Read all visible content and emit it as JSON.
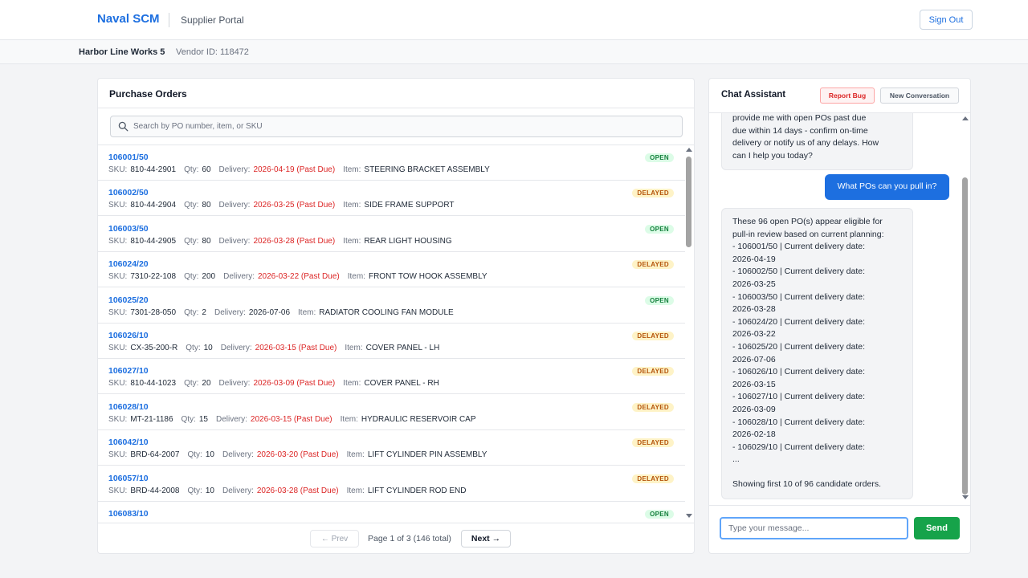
{
  "header": {
    "brand": "Naval SCM",
    "portal": "Supplier Portal",
    "sign_out": "Sign Out"
  },
  "vendor": {
    "name": "Harbor Line Works 5",
    "id_text": "Vendor ID: 118472"
  },
  "orders": {
    "title": "Purchase Orders",
    "search_placeholder": "Search by PO number, item, or SKU",
    "labels": {
      "sku": "SKU:",
      "qty": "Qty:",
      "delivery": "Delivery:",
      "item": "Item:"
    },
    "rows": [
      {
        "po": "106001/50",
        "sku": "810-44-2901",
        "qty": "60",
        "delivery": "2026-04-19 (Past Due)",
        "past_due": true,
        "item": "STEERING BRACKET ASSEMBLY",
        "status": "OPEN"
      },
      {
        "po": "106002/50",
        "sku": "810-44-2904",
        "qty": "80",
        "delivery": "2026-03-25 (Past Due)",
        "past_due": true,
        "item": "SIDE FRAME SUPPORT",
        "status": "DELAYED"
      },
      {
        "po": "106003/50",
        "sku": "810-44-2905",
        "qty": "80",
        "delivery": "2026-03-28 (Past Due)",
        "past_due": true,
        "item": "REAR LIGHT HOUSING",
        "status": "OPEN"
      },
      {
        "po": "106024/20",
        "sku": "7310-22-108",
        "qty": "200",
        "delivery": "2026-03-22 (Past Due)",
        "past_due": true,
        "item": "FRONT TOW HOOK ASSEMBLY",
        "status": "DELAYED"
      },
      {
        "po": "106025/20",
        "sku": "7301-28-050",
        "qty": "2",
        "delivery": "2026-07-06",
        "past_due": false,
        "item": "RADIATOR COOLING FAN MODULE",
        "status": "OPEN"
      },
      {
        "po": "106026/10",
        "sku": "CX-35-200-R",
        "qty": "10",
        "delivery": "2026-03-15 (Past Due)",
        "past_due": true,
        "item": "COVER PANEL - LH",
        "status": "DELAYED"
      },
      {
        "po": "106027/10",
        "sku": "810-44-1023",
        "qty": "20",
        "delivery": "2026-03-09 (Past Due)",
        "past_due": true,
        "item": "COVER PANEL - RH",
        "status": "DELAYED"
      },
      {
        "po": "106028/10",
        "sku": "MT-21-1186",
        "qty": "15",
        "delivery": "2026-03-15 (Past Due)",
        "past_due": true,
        "item": "HYDRAULIC RESERVOIR CAP",
        "status": "DELAYED"
      },
      {
        "po": "106042/10",
        "sku": "BRD-64-2007",
        "qty": "10",
        "delivery": "2026-03-20 (Past Due)",
        "past_due": true,
        "item": "LIFT CYLINDER PIN ASSEMBLY",
        "status": "DELAYED"
      },
      {
        "po": "106057/10",
        "sku": "BRD-44-2008",
        "qty": "10",
        "delivery": "2026-03-28 (Past Due)",
        "past_due": true,
        "item": "LIFT CYLINDER ROD END",
        "status": "DELAYED"
      },
      {
        "po": "106083/10",
        "sku": "",
        "qty": "",
        "delivery": "",
        "past_due": false,
        "item": "",
        "status": "OPEN"
      }
    ],
    "pager": {
      "prev": "← Prev",
      "info": "Page 1 of 3 (146 total)",
      "next": "Next →"
    }
  },
  "chat": {
    "title": "Chat Assistant",
    "report_bug": "Report Bug",
    "new_conversation": "New Conversation",
    "messages": [
      {
        "role": "bot",
        "text": "provide me with open POs past due\ndue within 14 days - confirm on-time\ndelivery or notify us of any delays. How\ncan I help you today?"
      },
      {
        "role": "user",
        "text": "What POs can you pull in?"
      },
      {
        "role": "bot",
        "text": "These 96 open PO(s) appear eligible for\npull-in review based on current planning:\n- 106001/50 | Current delivery date:\n2026-04-19\n- 106002/50 | Current delivery date:\n2026-03-25\n- 106003/50 | Current delivery date:\n2026-03-28\n- 106024/20 | Current delivery date:\n2026-03-22\n- 106025/20 | Current delivery date:\n2026-07-06\n- 106026/10 | Current delivery date:\n2026-03-15\n- 106027/10 | Current delivery date:\n2026-03-09\n- 106028/10 | Current delivery date:\n2026-02-18\n- 106029/10 | Current delivery date:\n...\n\nShowing first 10 of 96 candidate orders."
      }
    ],
    "input_placeholder": "Type your message...",
    "send": "Send"
  },
  "colors": {
    "accent": "#1d6fe0",
    "past_due": "#dc2626",
    "open_badge": "#15803d",
    "delayed_badge": "#b45309",
    "send": "#16a34a"
  }
}
